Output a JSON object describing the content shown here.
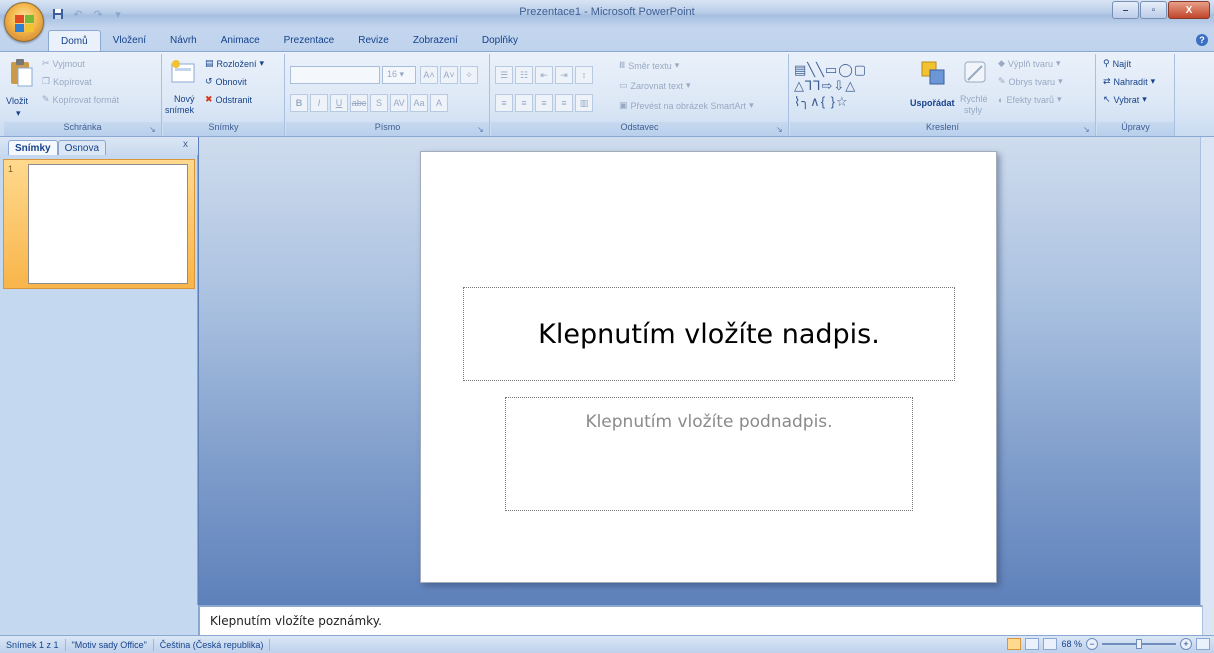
{
  "window": {
    "title": "Prezentace1 - Microsoft PowerPoint"
  },
  "tabs": [
    "Domů",
    "Vložení",
    "Návrh",
    "Animace",
    "Prezentace",
    "Revize",
    "Zobrazení",
    "Doplňky"
  ],
  "ribbon": {
    "clipboard": {
      "label": "Schránka",
      "paste": "Vložit",
      "cut": "Vyjmout",
      "copy": "Kopírovat",
      "format_painter": "Kopírovat formát"
    },
    "slides": {
      "label": "Snímky",
      "new_slide_1": "Nový",
      "new_slide_2": "snímek",
      "layout": "Rozložení",
      "reset": "Obnovit",
      "delete": "Odstranit"
    },
    "font": {
      "label": "Písmo",
      "size": "16"
    },
    "paragraph": {
      "label": "Odstavec",
      "text_direction": "Směr textu",
      "align_text": "Zarovnat text",
      "smartart": "Převést na obrázek SmartArt"
    },
    "drawing": {
      "label": "Kreslení",
      "arrange": "Uspořádat",
      "quick_styles_1": "Rychlé",
      "quick_styles_2": "styly",
      "shape_fill": "Výplň tvaru",
      "shape_outline": "Obrys tvaru",
      "shape_effects": "Efekty tvarů"
    },
    "editing": {
      "label": "Úpravy",
      "find": "Najít",
      "replace": "Nahradit",
      "select": "Vybrat"
    }
  },
  "left_pane": {
    "tab_slides": "Snímky",
    "tab_outline": "Osnova",
    "close": "x",
    "slide_number": "1"
  },
  "slide": {
    "title_placeholder": "Klepnutím vložíte nadpis.",
    "subtitle_placeholder": "Klepnutím vložíte podnadpis."
  },
  "notes": {
    "placeholder": "Klepnutím vložíte poznámky."
  },
  "status": {
    "slide": "Snímek 1 z 1",
    "theme": "\"Motiv sady Office\"",
    "language": "Čeština (Česká republika)",
    "zoom": "68 %"
  }
}
